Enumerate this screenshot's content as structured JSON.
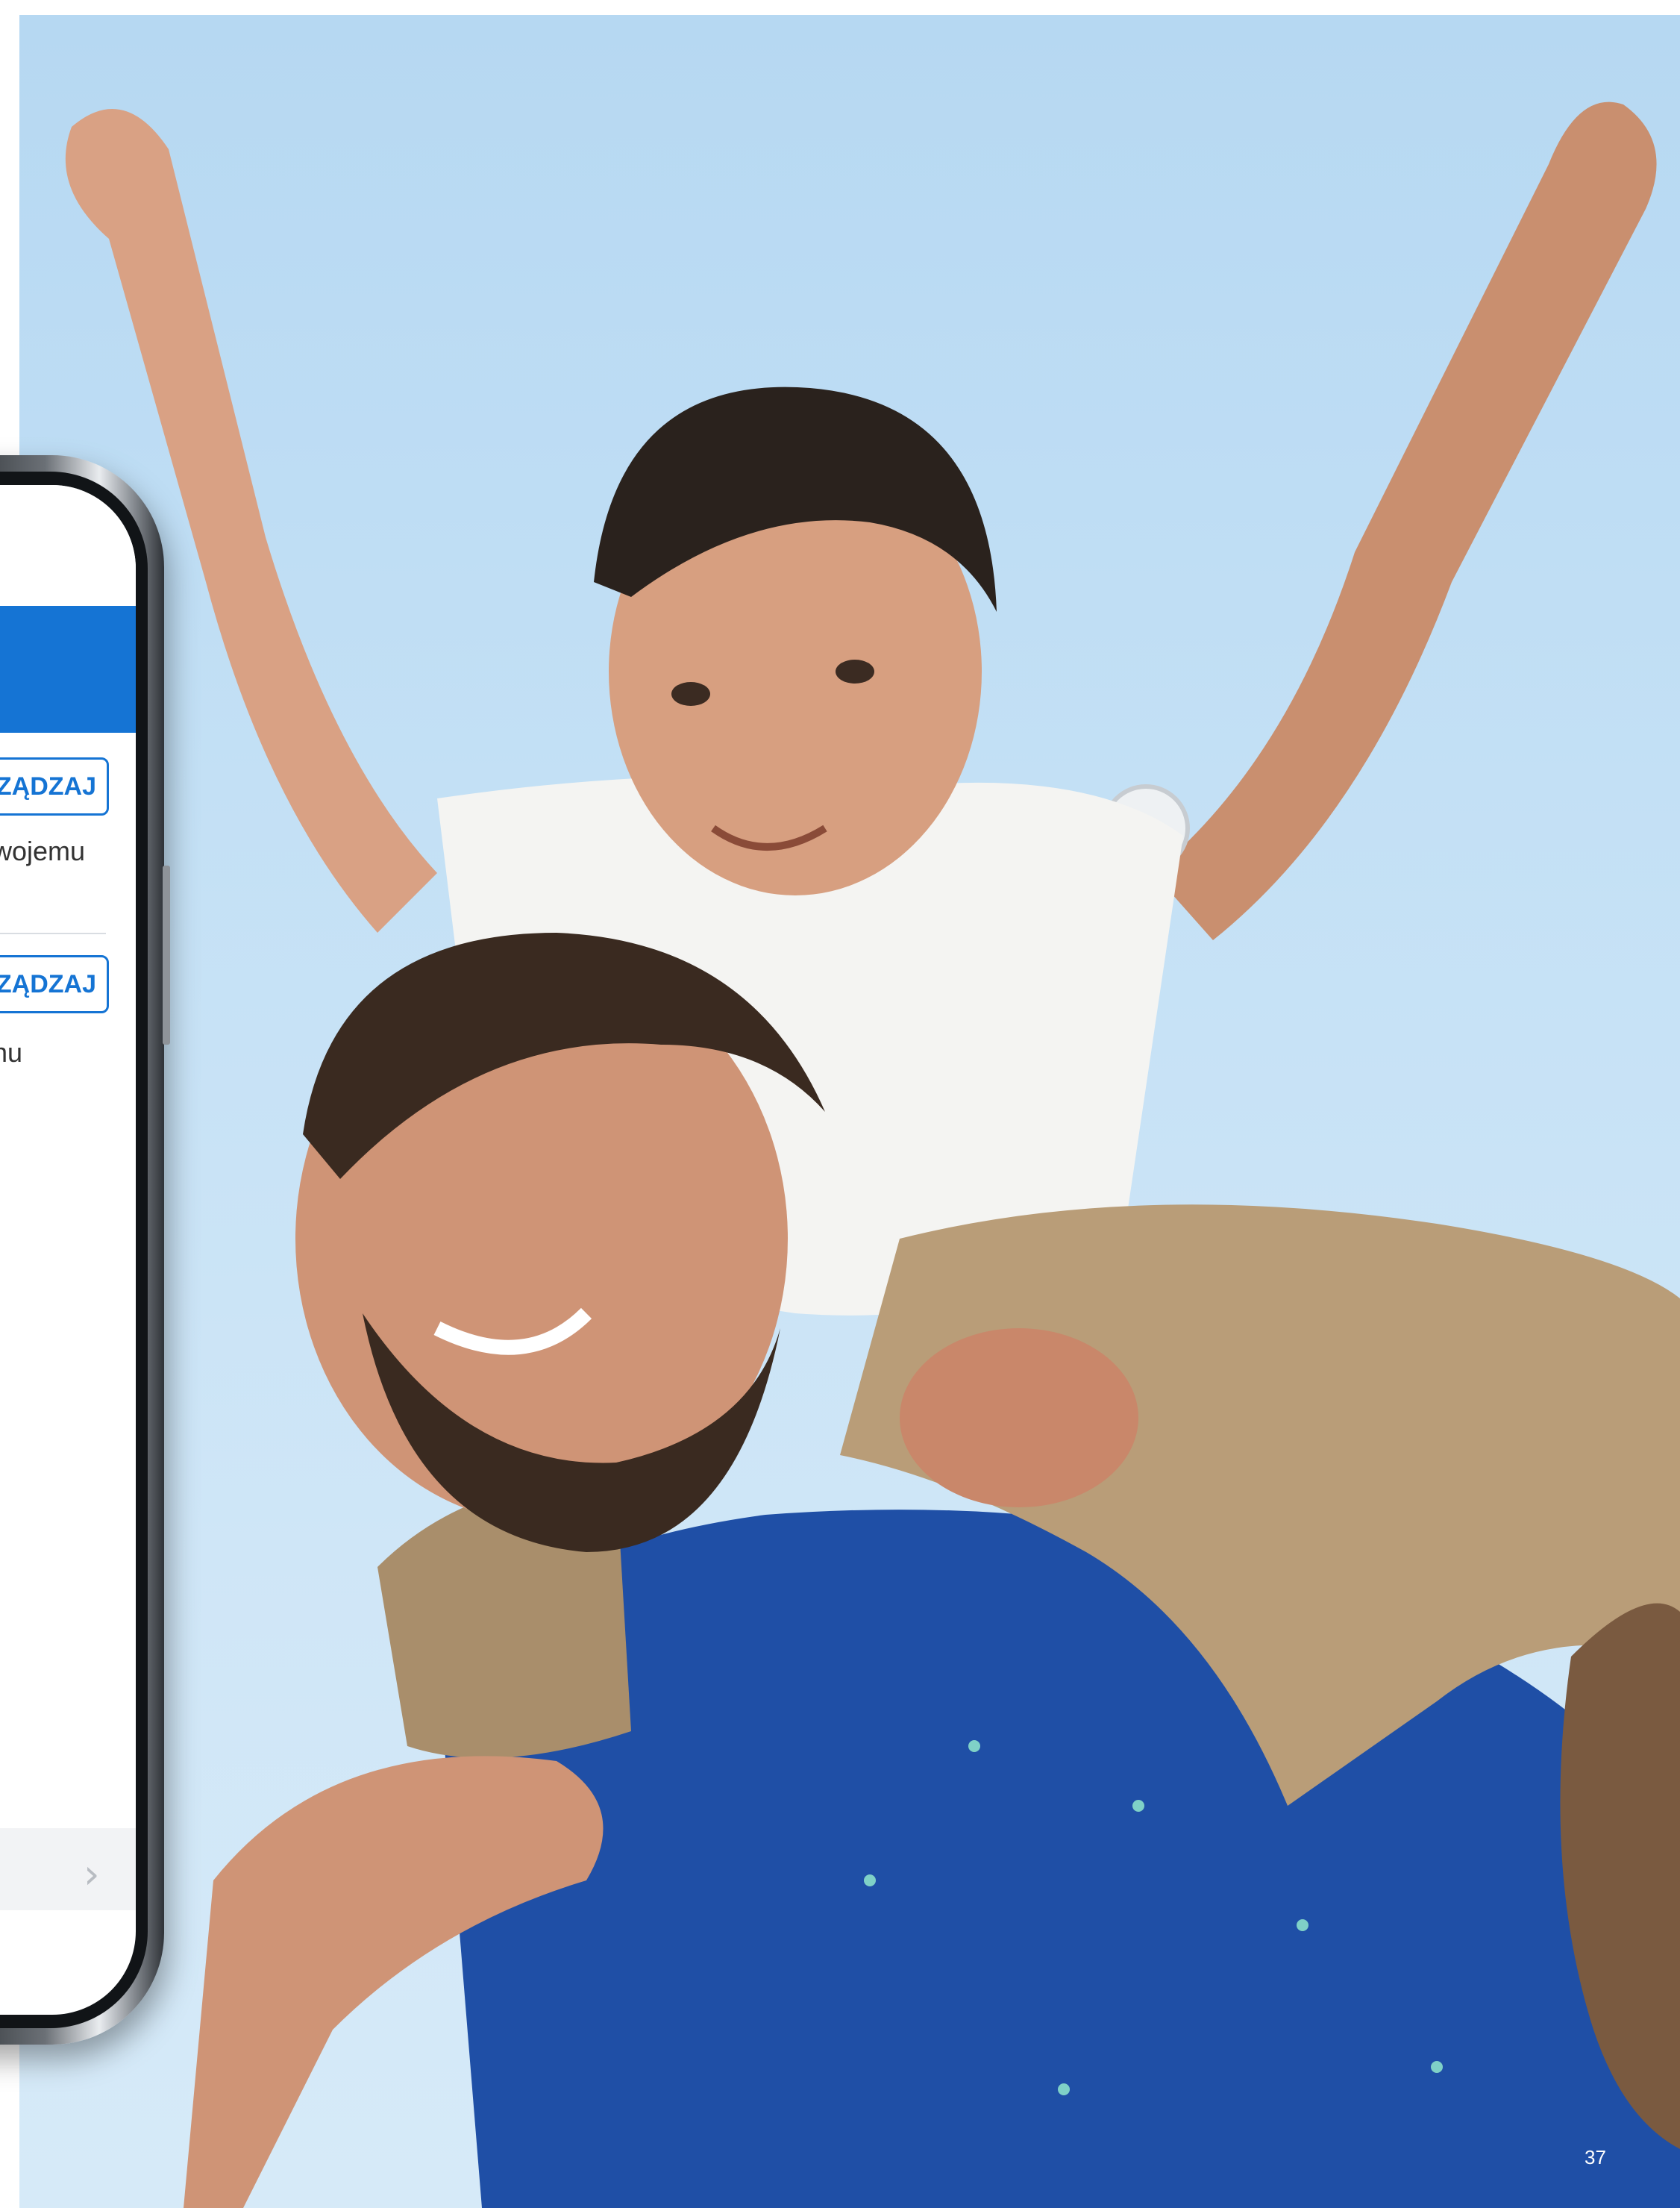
{
  "phone_screen": {
    "button_1_label": "ZĄDZAJ",
    "button_1_description": "wojemu",
    "button_2_label": "ZĄDZAJ",
    "button_2_description": "nu",
    "list_chevron": "›"
  },
  "page_number": "37",
  "colors": {
    "accent": "#1574d4",
    "sky": "#c3e0f5",
    "shirt_blue": "#1f4fa6"
  }
}
